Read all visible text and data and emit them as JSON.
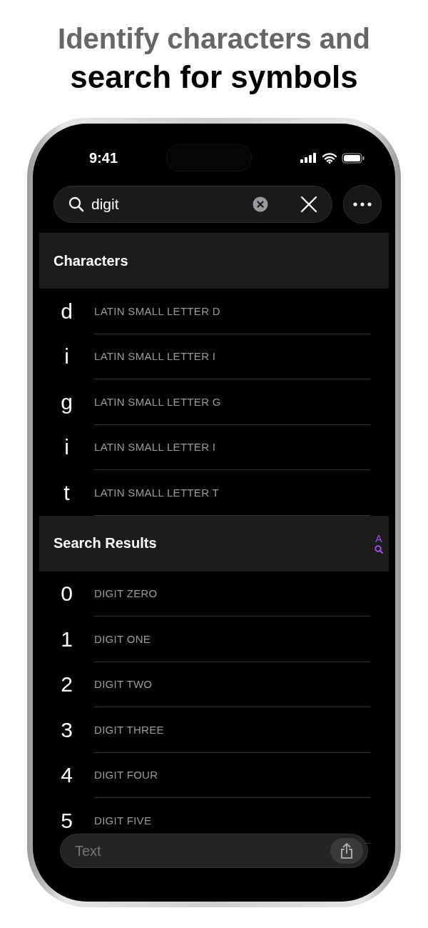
{
  "headline": {
    "line_1": "Identify characters and",
    "line_2": "search for symbols"
  },
  "status_bar": {
    "time": "9:41"
  },
  "search": {
    "value": "digit"
  },
  "sections": [
    {
      "title": "Characters",
      "rows": [
        {
          "glyph": "d",
          "name": "LATIN SMALL LETTER D"
        },
        {
          "glyph": "i",
          "name": "LATIN SMALL LETTER I"
        },
        {
          "glyph": "g",
          "name": "LATIN SMALL LETTER G"
        },
        {
          "glyph": "i",
          "name": "LATIN SMALL LETTER I"
        },
        {
          "glyph": "t",
          "name": "LATIN SMALL LETTER T"
        }
      ]
    },
    {
      "title": "Search Results",
      "index_letter": "A",
      "rows": [
        {
          "glyph": "0",
          "name": "DIGIT ZERO"
        },
        {
          "glyph": "1",
          "name": "DIGIT ONE"
        },
        {
          "glyph": "2",
          "name": "DIGIT TWO"
        },
        {
          "glyph": "3",
          "name": "DIGIT THREE"
        },
        {
          "glyph": "4",
          "name": "DIGIT FOUR"
        },
        {
          "glyph": "5",
          "name": "DIGIT FIVE"
        }
      ]
    }
  ],
  "text_bar": {
    "placeholder": "Text"
  }
}
